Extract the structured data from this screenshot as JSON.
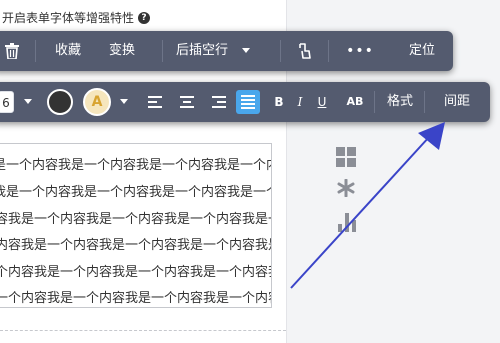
{
  "settings": {
    "label": "开启表单字体等增强特性",
    "help_icon": "?"
  },
  "toolbar1": {
    "delete_icon": "trash-icon",
    "collect": "收藏",
    "replace": "变换",
    "insert_blank_line": "后插空行",
    "format_brush_icon": "format-brush-icon",
    "more": "•••",
    "locate": "定位"
  },
  "toolbar2": {
    "font_size": "6",
    "font_color": "#333333",
    "bg_color_letter": "A",
    "bold": "B",
    "italic": "I",
    "underline": "U",
    "case": "AB",
    "format": "格式",
    "spacing": "间距",
    "active_align_color": "#4aa7ec"
  },
  "content": {
    "lines": [
      "是一个内容我是一个内容我是一个内容我是一个内",
      "我是一个内容我是一个内容我是一个内容我是一个",
      "容我是一个内容我是一个内容我是一个内容我是一",
      "内容我是一个内容我是一个内容我是一个内容我是",
      "个内容我是一个内容我是一个内容我是一个内容我",
      "一个内容我是一个内容我是一个内容我是一个内容"
    ]
  },
  "colors": {
    "toolbar_bg": "#545b6f",
    "arrow": "#3a44c8"
  }
}
